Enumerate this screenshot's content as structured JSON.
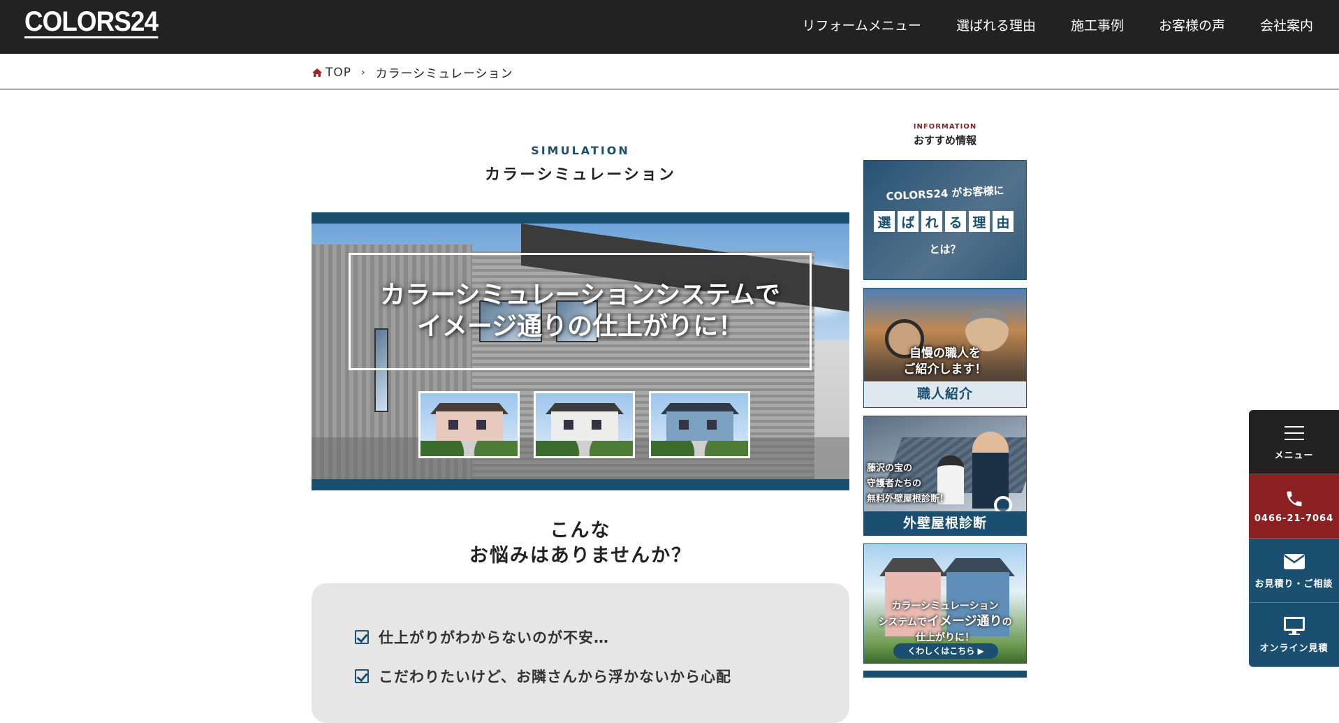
{
  "header": {
    "logo": "COLORS24",
    "nav": [
      "リフォームメニュー",
      "選ばれる理由",
      "施工事例",
      "お客様の声",
      "会社案内"
    ]
  },
  "breadcrumb": {
    "home": "TOP",
    "current": "カラーシミュレーション"
  },
  "section": {
    "en": "SIMULATION",
    "jp": "カラーシミュレーション"
  },
  "hero": {
    "line1": "カラーシミュレーションシステムで",
    "line2": "イメージ通りの仕上がりに！"
  },
  "worries": {
    "title_line1": "こんな",
    "title_line2": "お悩みはありませんか？",
    "items": [
      "仕上がりがわからないのが不安…",
      "こだわりたいけど、お隣さんから浮かないから心配"
    ]
  },
  "sidebar": {
    "en": "INFORMATION",
    "jp": "おすすめ情報",
    "banner1": {
      "top": "COLORS24 がお客様に",
      "chars": [
        "選",
        "ば",
        "れ",
        "る",
        "理",
        "由"
      ],
      "bottom": "とは？"
    },
    "banner2": {
      "line1": "自慢の職人を",
      "line2": "ご紹介します！",
      "bar": "職人紹介"
    },
    "banner3": {
      "line1": "藤沢の宝の",
      "line2": "守護者たちの",
      "line3": "無料外壁屋根診断！",
      "bar": "外壁屋根診断"
    },
    "banner4": {
      "line1": "カラーシミュレーション",
      "line2a": "システムで",
      "line2b": "イメージ通り",
      "line2c": "の",
      "line3": "仕上がりに！",
      "cta": "くわしくはこちら ▶"
    }
  },
  "floating": {
    "menu": "メニュー",
    "tel": "0466-21-7064",
    "mail": "お見積り・ご相談",
    "online": "オンライン見積"
  },
  "colors": {
    "header_bg": "#222222",
    "accent_blue": "#1b4f6f",
    "accent_red": "#8c1f1f"
  }
}
